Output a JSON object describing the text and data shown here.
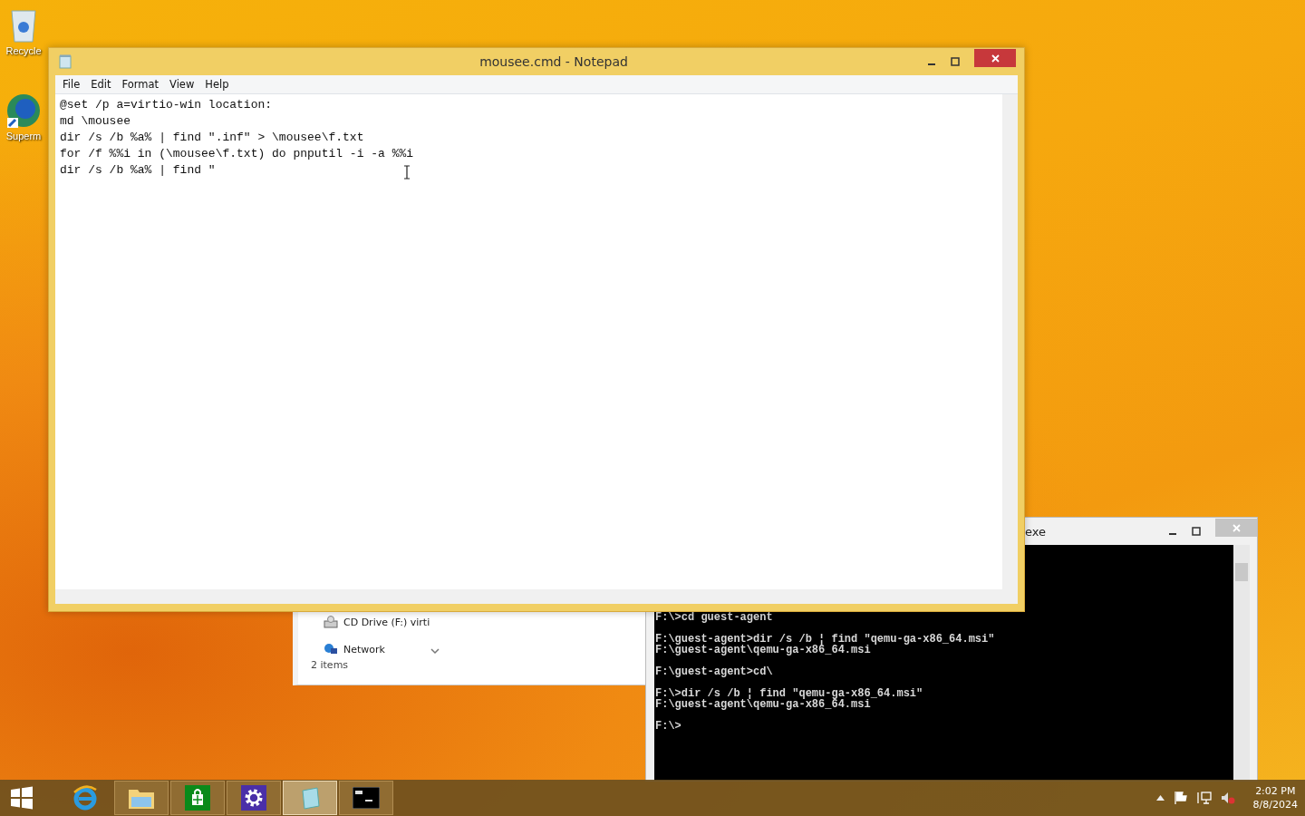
{
  "desktop_icons": [
    {
      "label": "Recycle",
      "kind": "bin"
    },
    {
      "label": "Superm",
      "kind": "globe"
    }
  ],
  "explorer": {
    "items": [
      {
        "label": "CD Drive (F:) virti",
        "kind": "drive"
      },
      {
        "label": "Network",
        "kind": "network"
      }
    ],
    "status": "2 items"
  },
  "console": {
    "title": "exe",
    "blocks": [
      [
        "F:\\>cd guest-agent"
      ],
      [
        "F:\\guest-agent>dir /s /b ¦ find \"qemu-ga-x86_64.msi\"",
        "F:\\guest-agent\\qemu-ga-x86_64.msi"
      ],
      [
        "F:\\guest-agent>cd\\"
      ],
      [
        "F:\\>dir /s /b ¦ find \"qemu-ga-x86_64.msi\"",
        "F:\\guest-agent\\qemu-ga-x86_64.msi"
      ],
      [
        "F:\\>"
      ]
    ]
  },
  "notepad": {
    "title": "mousee.cmd - Notepad",
    "menu": [
      "File",
      "Edit",
      "Format",
      "View",
      "Help"
    ],
    "lines": [
      "@set /p a=virtio-win location:",
      "md \\mousee",
      "dir /s /b %a% | find \".inf\" > \\mousee\\f.txt",
      "for /f %%i in (\\mousee\\f.txt) do pnputil -i -a %%i",
      "dir /s /b %a% | find \""
    ]
  },
  "taskbar": {
    "apps": [
      {
        "kind": "ie",
        "selected": false
      },
      {
        "kind": "folder",
        "selected": false
      },
      {
        "kind": "store",
        "selected": false
      },
      {
        "kind": "settings",
        "selected": false
      },
      {
        "kind": "notepad",
        "selected": true
      },
      {
        "kind": "cmd",
        "selected": false
      }
    ],
    "time": "2:02 PM",
    "date": "8/8/2024"
  }
}
